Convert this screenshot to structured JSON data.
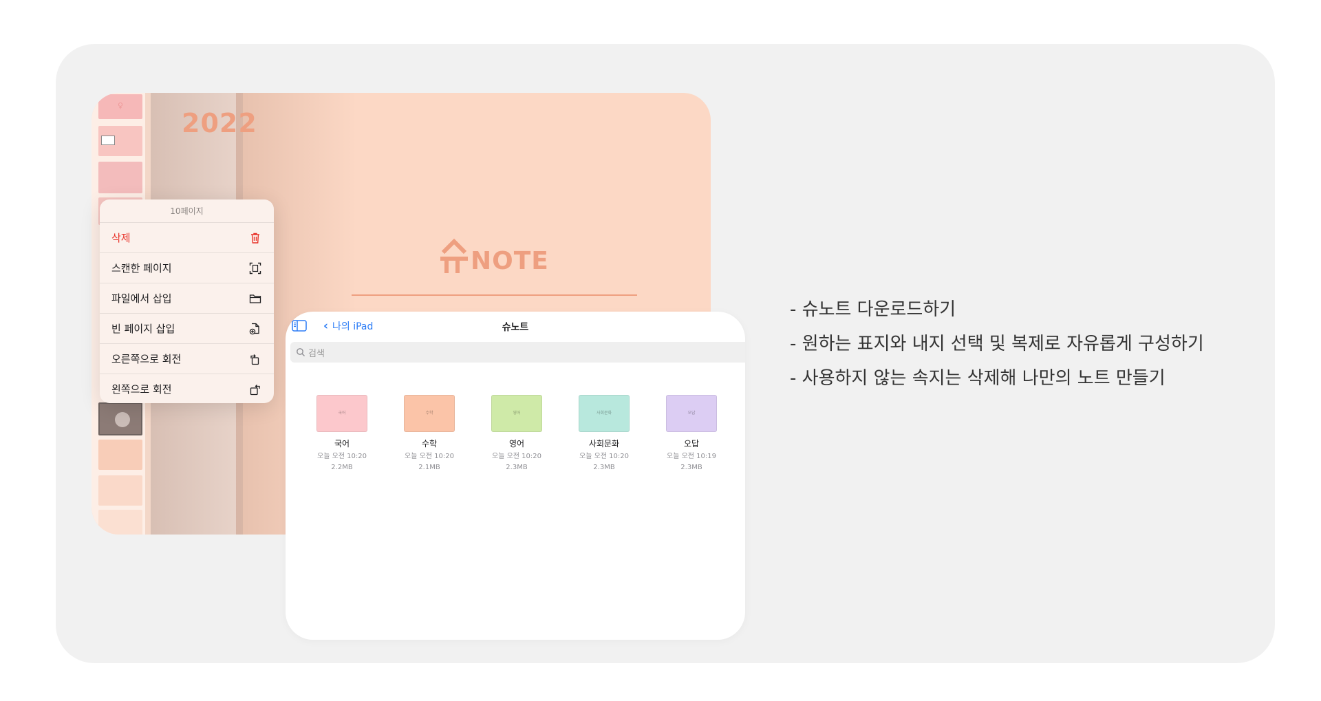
{
  "note_app": {
    "year": "2022",
    "logo_word": "NOTE",
    "context_menu": {
      "title": "10페이지",
      "items": [
        {
          "label": "삭제",
          "icon": "trash-icon",
          "danger": true
        },
        {
          "label": "스캔한 페이지",
          "icon": "scan-icon"
        },
        {
          "label": "파일에서 삽입",
          "icon": "folder-icon"
        },
        {
          "label": "빈 페이지 삽입",
          "icon": "add-page-icon"
        },
        {
          "label": "오른쪽으로 회전",
          "icon": "rotate-right-icon"
        },
        {
          "label": "왼쪽으로 회전",
          "icon": "rotate-left-icon"
        }
      ]
    }
  },
  "files_app": {
    "back_label": "나의 iPad",
    "title": "슈노트",
    "search_placeholder": "검색",
    "files": [
      {
        "name": "국어",
        "date": "오늘 오전 10:20",
        "size": "2.2MB",
        "color": "#fcc8cc",
        "cover_label": "국어"
      },
      {
        "name": "수학",
        "date": "오늘 오전 10:20",
        "size": "2.1MB",
        "color": "#fbc4a8",
        "cover_label": "수학"
      },
      {
        "name": "영어",
        "date": "오늘 오전 10:20",
        "size": "2.3MB",
        "color": "#cfeaa8",
        "cover_label": "영어"
      },
      {
        "name": "사회문화",
        "date": "오늘 오전 10:20",
        "size": "2.3MB",
        "color": "#b8e8dd",
        "cover_label": "사회문화"
      },
      {
        "name": "오답",
        "date": "오늘 오전 10:19",
        "size": "2.3MB",
        "color": "#dccdf3",
        "cover_label": "오답"
      }
    ]
  },
  "bullets": [
    "- 슈노트 다운로드하기",
    "- 원하는 표지와 내지 선택 및 복제로 자유롭게 구성하기",
    "- 사용하지 않는 속지는 삭제해 나만의 노트 만들기"
  ],
  "colors": {
    "panel_bg": "#f1f1f1",
    "cover_bg": "#fcd8c5",
    "accent": "#ee9f80",
    "link_blue": "#2b7cf6",
    "danger_red": "#e8332a"
  }
}
